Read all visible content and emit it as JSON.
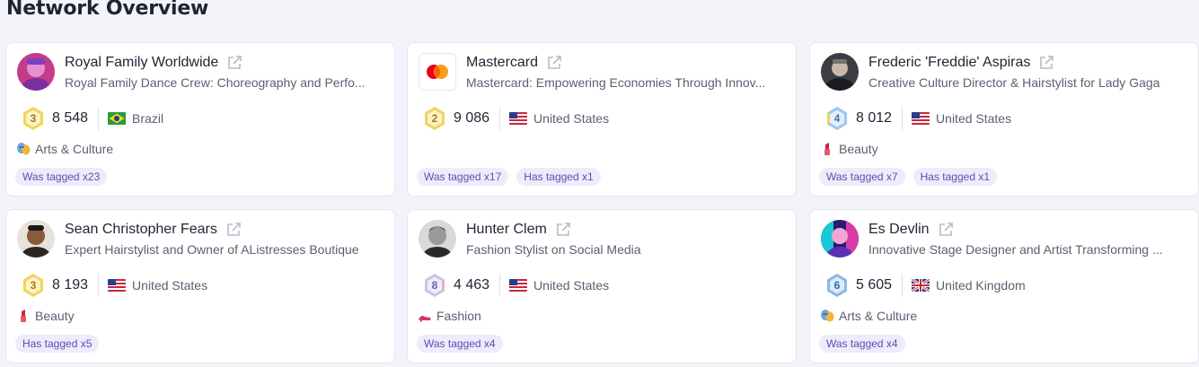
{
  "page": {
    "title": "Network Overview"
  },
  "cards": [
    {
      "name": "Royal Family Worldwide",
      "description": "Royal Family Dance Crew: Choreography and Perfo...",
      "level": "3",
      "followers": "8 548",
      "country": "Brazil",
      "category": "Arts & Culture",
      "tags": [
        "Was tagged x23"
      ]
    },
    {
      "name": "Mastercard",
      "description": "Mastercard: Empowering Economies Through Innov...",
      "level": "2",
      "followers": "9 086",
      "country": "United States",
      "category": "",
      "tags": [
        "Was tagged x17",
        "Has tagged x1"
      ]
    },
    {
      "name": "Frederic 'Freddie' Aspiras",
      "description": "Creative Culture Director & Hairstylist for Lady Gaga",
      "level": "4",
      "followers": "8 012",
      "country": "United States",
      "category": "Beauty",
      "tags": [
        "Was tagged x7",
        "Has tagged x1"
      ]
    },
    {
      "name": "Sean Christopher Fears",
      "description": "Expert Hairstylist and Owner of AListresses Boutique",
      "level": "3",
      "followers": "8 193",
      "country": "United States",
      "category": "Beauty",
      "tags": [
        "Has tagged x5"
      ]
    },
    {
      "name": "Hunter Clem",
      "description": "Fashion Stylist on Social Media",
      "level": "8",
      "followers": "4 463",
      "country": "United States",
      "category": "Fashion",
      "tags": [
        "Was tagged x4"
      ]
    },
    {
      "name": "Es Devlin",
      "description": "Innovative Stage Designer and Artist Transforming ...",
      "level": "6",
      "followers": "5 605",
      "country": "United Kingdom",
      "category": "Arts & Culture",
      "tags": [
        "Was tagged x4"
      ]
    }
  ],
  "colors": {
    "tag_bg": "#eeebfb",
    "tag_text": "#5b4fb1",
    "gold_badge": "#f3d35c",
    "silver_badge": "#d7d9e6",
    "blue_badge": "#9fc6f0"
  }
}
